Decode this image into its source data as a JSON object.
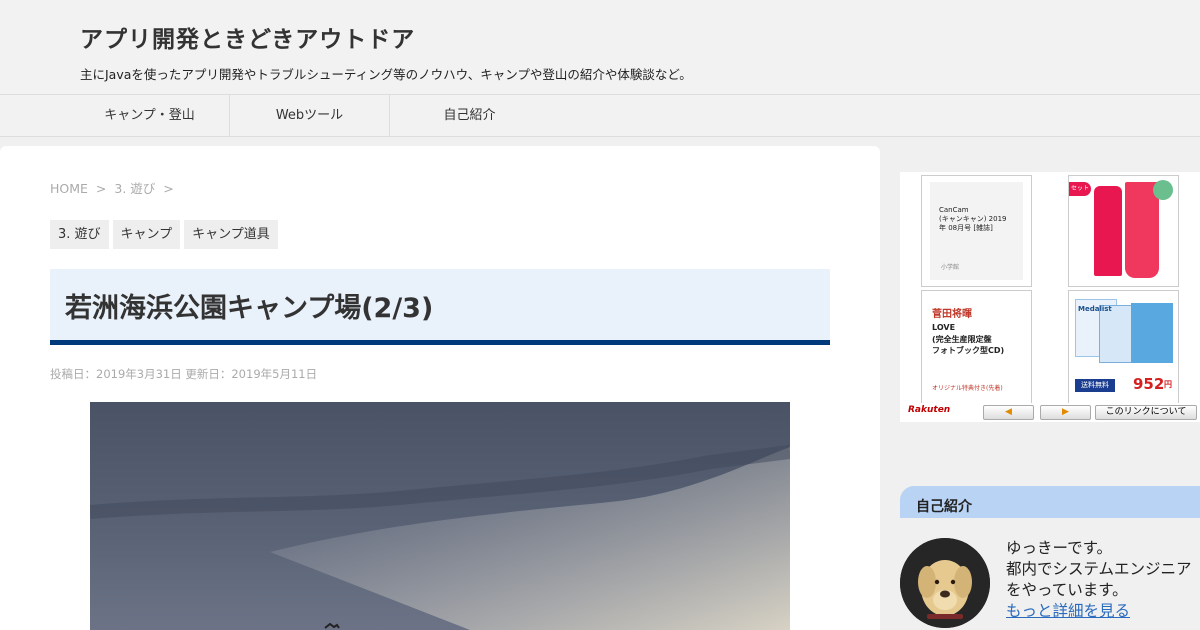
{
  "site": {
    "title": "アプリ開発ときどきアウトドア",
    "description": "主にJavaを使ったアプリ開発やトラブルシューティング等のノウハウ、キャンプや登山の紹介や体験談など。"
  },
  "nav": {
    "items": [
      {
        "label": "キャンプ・登山"
      },
      {
        "label": "Webツール"
      },
      {
        "label": "自己紹介"
      }
    ]
  },
  "breadcrumb": {
    "home": "HOME",
    "sep1": ">",
    "category": "3. 遊び",
    "sep2": ">"
  },
  "tags": [
    "3. 遊び",
    "キャンプ",
    "キャンプ道具"
  ],
  "post": {
    "title": "若洲海浜公園キャンプ場(2/3)",
    "dates": "投稿日：2019年3月31日 更新日：2019年5月11日"
  },
  "ad": {
    "product1": {
      "title": "CanCam\n(キャンキャン) 2019\n年 08月号 [雑誌]",
      "publisher": "小学館"
    },
    "product2": {
      "badge": "セット"
    },
    "product3": {
      "line1": "菅田将暉",
      "line2": "LOVE",
      "line3": "(完全生産限定盤",
      "line4": "フォトブック型CD)",
      "note": "オリジナル特典付き(先着)"
    },
    "product4": {
      "brand": "Medalist",
      "shipping": "送料無料",
      "price": "952",
      "unit": "円"
    },
    "logo": "Rakuten",
    "about_label": "このリンクについて",
    "prev_label": "◀",
    "next_label": "▶"
  },
  "sidebar": {
    "widget_title": "自己紹介",
    "profile": {
      "line1": "ゆっきーです。",
      "line2": "都内でシステムエンジニア",
      "line3": "をやっています。",
      "more_link": "もっと詳細を見る"
    }
  },
  "colors": {
    "title_underline": "#003a7a",
    "title_bg": "#e9f1fb",
    "widget_bg": "#b9d3f5",
    "link": "#2a6bbd"
  }
}
